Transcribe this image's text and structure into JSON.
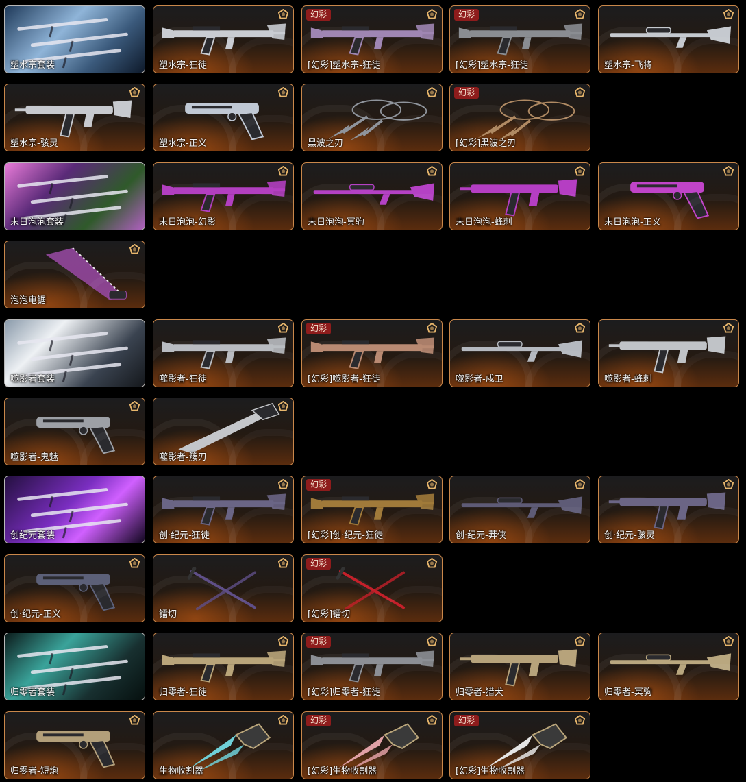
{
  "ui": {
    "variant_badge": "幻彩",
    "colors": {
      "accent_border": "#c9874a",
      "variant_badge_bg": "#8e1c1c",
      "tier_icon": "#e7b66c"
    }
  },
  "rows": [
    [
      {
        "label": "塑水宗套装",
        "kind": "set",
        "art": "ocean"
      },
      {
        "label": "塑水宗-狂徒",
        "kind": "rifle",
        "tint": "#c9ccd2",
        "tier": true
      },
      {
        "label": "[幻彩]塑水宗-狂徒",
        "kind": "rifle",
        "tint": "#9f86b3",
        "tier": true,
        "variant": true
      },
      {
        "label": "[幻彩]塑水宗-狂徒",
        "kind": "rifle",
        "tint": "#8a8d92",
        "tier": true,
        "variant": true
      },
      {
        "label": "塑水宗-飞将",
        "kind": "sniper",
        "tint": "#c5c9cf",
        "tier": true
      }
    ],
    [
      {
        "label": "塑水宗-骇灵",
        "kind": "smg",
        "tint": "#c7c9ce",
        "tier": true
      },
      {
        "label": "塑水宗-正义",
        "kind": "pistol",
        "tint": "#c0c8d4",
        "tier": true
      },
      {
        "label": "黑波之刃",
        "kind": "kunai",
        "tint": "#8f949c",
        "tier": true
      },
      {
        "label": "[幻彩]黑波之刃",
        "kind": "kunai",
        "tint": "#b08a63",
        "tier": true,
        "variant": true
      }
    ],
    [
      {
        "label": "末日泡泡套装",
        "kind": "set",
        "art": "bubble"
      },
      {
        "label": "末日泡泡-幻影",
        "kind": "rifle",
        "tint": "#b23fc0",
        "tier": true
      },
      {
        "label": "末日泡泡-冥驹",
        "kind": "sniper",
        "tint": "#b441c4",
        "tier": true
      },
      {
        "label": "末日泡泡-蜂刺",
        "kind": "smg",
        "tint": "#b53ec3",
        "tier": true
      },
      {
        "label": "末日泡泡-正义",
        "kind": "pistol",
        "tint": "#c044c8",
        "tier": true
      }
    ],
    [
      {
        "label": "泡泡电锯",
        "kind": "saw",
        "tint": "#9a4aa6",
        "tier": true
      }
    ],
    [
      {
        "label": "噬影者套装",
        "kind": "set",
        "art": "shadow"
      },
      {
        "label": "噬影者-狂徒",
        "kind": "rifle",
        "tint": "#b9bcc1",
        "tier": true
      },
      {
        "label": "[幻彩]噬影者-狂徒",
        "kind": "rifle",
        "tint": "#b98a72",
        "tier": true,
        "variant": true
      },
      {
        "label": "噬影者-戍卫",
        "kind": "sniper",
        "tint": "#b5b9bf",
        "tier": true
      },
      {
        "label": "噬影者-蜂刺",
        "kind": "smg",
        "tint": "#c0c3c7",
        "tier": true
      }
    ],
    [
      {
        "label": "噬影者-鬼魅",
        "kind": "pistol",
        "tint": "#9da0a6",
        "tier": true
      },
      {
        "label": "噬影者-簇刃",
        "kind": "dagger",
        "tint": "#c4c6ca",
        "tier": true
      }
    ],
    [
      {
        "label": "创纪元套装",
        "kind": "set",
        "art": "genesis"
      },
      {
        "label": "创·纪元-狂徒",
        "kind": "rifle",
        "tint": "#6a6585",
        "tier": true
      },
      {
        "label": "[幻彩]创·纪元-狂徒",
        "kind": "rifle",
        "tint": "#a07a3a",
        "tier": true,
        "variant": true
      },
      {
        "label": "创·纪元-莽侠",
        "kind": "sniper",
        "tint": "#5e5b76",
        "tier": true
      },
      {
        "label": "创·纪元-骇灵",
        "kind": "smg",
        "tint": "#6b6585",
        "tier": true
      }
    ],
    [
      {
        "label": "创·纪元-正义",
        "kind": "pistol",
        "tint": "#5c6078",
        "tier": true
      },
      {
        "label": "镭切",
        "kind": "swords",
        "tint": "#5f4f88",
        "tier": true
      },
      {
        "label": "[幻彩]镭切",
        "kind": "swords",
        "tint": "#c4202a",
        "tier": true,
        "variant": true
      }
    ],
    [
      {
        "label": "归零者套装",
        "kind": "set",
        "art": "zero"
      },
      {
        "label": "归零者-狂徒",
        "kind": "rifle",
        "tint": "#b9a57a",
        "tier": true
      },
      {
        "label": "[幻彩]归零者-狂徒",
        "kind": "rifle",
        "tint": "#8c8f95",
        "tier": true,
        "variant": true
      },
      {
        "label": "归零者-猎犬",
        "kind": "smg",
        "tint": "#b7a37b",
        "tier": true
      },
      {
        "label": "归零者-冥驹",
        "kind": "sniper",
        "tint": "#b9a77f",
        "tier": true
      }
    ],
    [
      {
        "label": "归零者-短炮",
        "kind": "pistol",
        "tint": "#b29f7a",
        "tier": true
      },
      {
        "label": "生物收割器",
        "kind": "claw",
        "tint": "#6fd0d8",
        "tier": true
      },
      {
        "label": "[幻彩]生物收割器",
        "kind": "claw",
        "tint": "#e0a0a6",
        "tier": true,
        "variant": true
      },
      {
        "label": "[幻彩]生物收割器",
        "kind": "claw",
        "tint": "#e5e5e5",
        "tier": true,
        "variant": true
      }
    ]
  ]
}
